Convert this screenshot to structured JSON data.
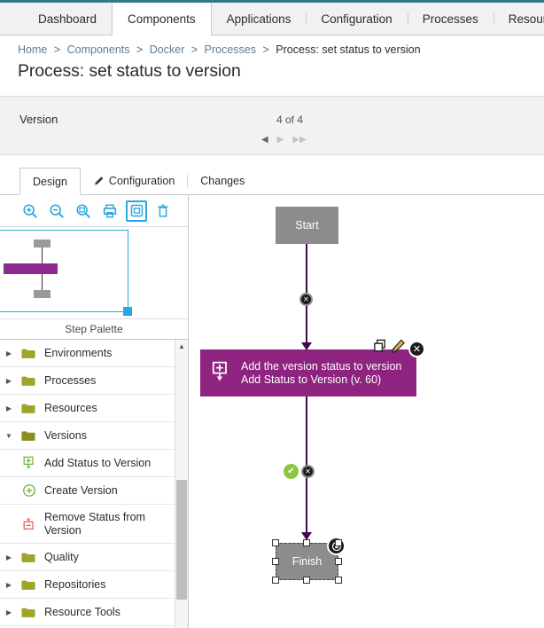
{
  "topnav": {
    "tabs": [
      {
        "label": "Dashboard",
        "active": false
      },
      {
        "label": "Components",
        "active": true
      },
      {
        "label": "Applications",
        "active": false
      },
      {
        "label": "Configuration",
        "active": false
      },
      {
        "label": "Processes",
        "active": false
      },
      {
        "label": "Resources",
        "active": false
      }
    ]
  },
  "breadcrumb": {
    "items": [
      "Home",
      "Components",
      "Docker",
      "Processes"
    ],
    "current": "Process: set status to version",
    "separator": ">"
  },
  "page": {
    "title": "Process: set status to version"
  },
  "version": {
    "label": "Version",
    "count": "4 of 4",
    "prev_glyph": "◀",
    "next_glyph": "▶",
    "last_glyph": "▶▶"
  },
  "subtabs": {
    "tabs": [
      {
        "label": "Design",
        "active": true,
        "icon": ""
      },
      {
        "label": "Configuration",
        "active": false,
        "icon": "pencil-icon"
      },
      {
        "label": "Changes",
        "active": false,
        "icon": ""
      }
    ]
  },
  "toolbar": {
    "buttons": [
      {
        "name": "zoom-in-icon",
        "title": "Zoom In",
        "selected": false
      },
      {
        "name": "zoom-out-icon",
        "title": "Zoom Out",
        "selected": false
      },
      {
        "name": "zoom-fit-icon",
        "title": "Zoom to Fit",
        "selected": false
      },
      {
        "name": "print-icon",
        "title": "Print",
        "selected": false
      },
      {
        "name": "minimap-icon",
        "title": "Overview",
        "selected": true
      },
      {
        "name": "trash-icon",
        "title": "Delete",
        "selected": false
      }
    ]
  },
  "palette": {
    "header": "Step Palette",
    "items": [
      {
        "label": "Environments",
        "type": "folder",
        "expanded": false,
        "icon": "folder-icon"
      },
      {
        "label": "Processes",
        "type": "folder",
        "expanded": false,
        "icon": "folder-icon"
      },
      {
        "label": "Resources",
        "type": "folder",
        "expanded": false,
        "icon": "folder-icon"
      },
      {
        "label": "Versions",
        "type": "folder",
        "expanded": true,
        "icon": "folder-open-icon"
      },
      {
        "label": "Add Status to Version",
        "type": "leaf",
        "icon": "add-status-icon"
      },
      {
        "label": "Create Version",
        "type": "leaf",
        "icon": "create-version-icon"
      },
      {
        "label": "Remove Status from Version",
        "type": "leaf",
        "icon": "remove-status-icon"
      },
      {
        "label": "Quality",
        "type": "folder",
        "expanded": false,
        "icon": "folder-icon"
      },
      {
        "label": "Repositories",
        "type": "folder",
        "expanded": false,
        "icon": "folder-icon"
      },
      {
        "label": "Resource Tools",
        "type": "folder",
        "expanded": false,
        "icon": "folder-icon"
      }
    ],
    "collapsed_arrow": "▶",
    "expanded_arrow": "▼"
  },
  "diagram": {
    "start_label": "Start",
    "finish_label": "Finish",
    "step": {
      "line1": "Add the version status to version",
      "line2": "Add Status to Version (v. 60)",
      "icon": "add-status-icon",
      "actions": [
        {
          "name": "copy-icon",
          "glyph": ""
        },
        {
          "name": "edit-icon",
          "glyph": ""
        },
        {
          "name": "delete-icon",
          "glyph": "✕"
        }
      ]
    },
    "edge_badge_glyph": "✕",
    "success_badge_glyph": "✔"
  },
  "colors": {
    "accent_teal": "#2d7d8e",
    "step_purple": "#8e2380",
    "edge_purple": "#3b0b4d",
    "node_gray": "#8c8c8c",
    "select_blue": "#29a8e0",
    "success_green": "#8cc63e",
    "folder_olive": "#9fa529",
    "link_blue": "#5f7d95"
  }
}
